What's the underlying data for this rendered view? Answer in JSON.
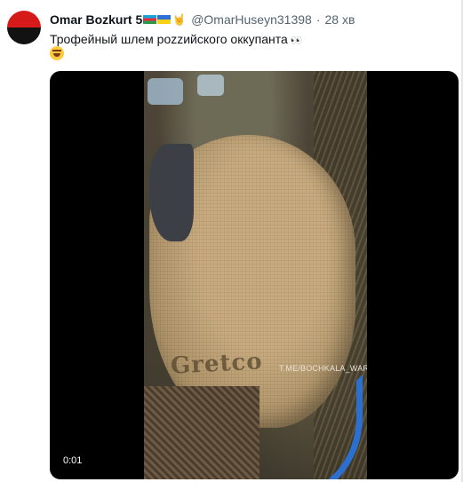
{
  "tweet": {
    "author_name": "Omar Bozkurt 5",
    "handle": "@OmarHuseyn31398",
    "separator": "·",
    "time": "28 хв",
    "text": "Трофейный шлем роzzийского оккупанта",
    "emoji_icons": [
      "flag-azerbaijan-icon",
      "flag-ukraine-icon",
      "sign-of-horns-icon",
      "eyes-icon",
      "rolling-laughing-icon"
    ]
  },
  "media": {
    "type": "video",
    "helmet_stamp": "Gretco",
    "watermark": "T.ME/BOCHKALA_WAR",
    "elapsed_time": "0:01"
  },
  "colors": {
    "text_primary": "#0f1419",
    "text_secondary": "#536471",
    "avatar_red": "#d61a1a",
    "avatar_black": "#121212"
  }
}
